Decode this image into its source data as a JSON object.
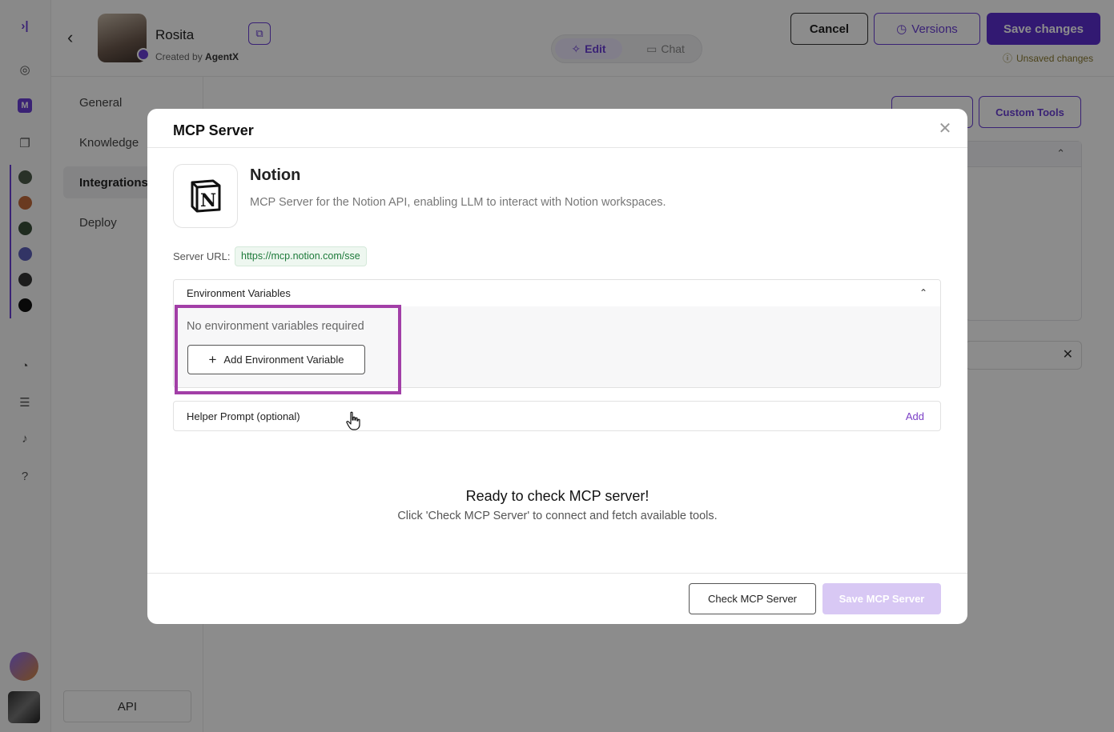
{
  "background": {
    "agent": {
      "name": "Rosita",
      "created_prefix": "Created by",
      "created_by": "AgentX"
    },
    "mode_toggle": {
      "edit_label": "Edit",
      "chat_label": "Chat"
    },
    "header_buttons": {
      "cancel": "Cancel",
      "versions": "Versions",
      "save_changes": "Save changes"
    },
    "unsaved_text": "Unsaved changes",
    "subnav": {
      "items": [
        "General",
        "Knowledge",
        "Integrations",
        "Deploy"
      ],
      "active": "Integrations",
      "api_label": "API"
    },
    "custom_tools_label": "Custom Tools"
  },
  "modal": {
    "title": "MCP Server",
    "server": {
      "logo_letter": "N",
      "name": "Notion",
      "description": "MCP Server for the Notion API, enabling LLM to interact with Notion workspaces."
    },
    "url_label": "Server URL:",
    "url_value": "https://mcp.notion.com/sse",
    "env_section": {
      "title": "Environment Variables",
      "empty_text": "No environment variables required",
      "add_button": "Add Environment Variable"
    },
    "helper_section": {
      "title": "Helper Prompt (optional)",
      "add_label": "Add"
    },
    "status": {
      "title": "Ready to check MCP server!",
      "subtitle": "Click 'Check MCP Server' to connect and fetch available tools."
    },
    "footer": {
      "check_button": "Check MCP Server",
      "save_button": "Save MCP Server"
    }
  },
  "colors": {
    "accent": "#6a3fd6",
    "highlight": "#a23fa7",
    "url_green": "#1d7a3a",
    "disabled_save": "#d8c8f4"
  }
}
